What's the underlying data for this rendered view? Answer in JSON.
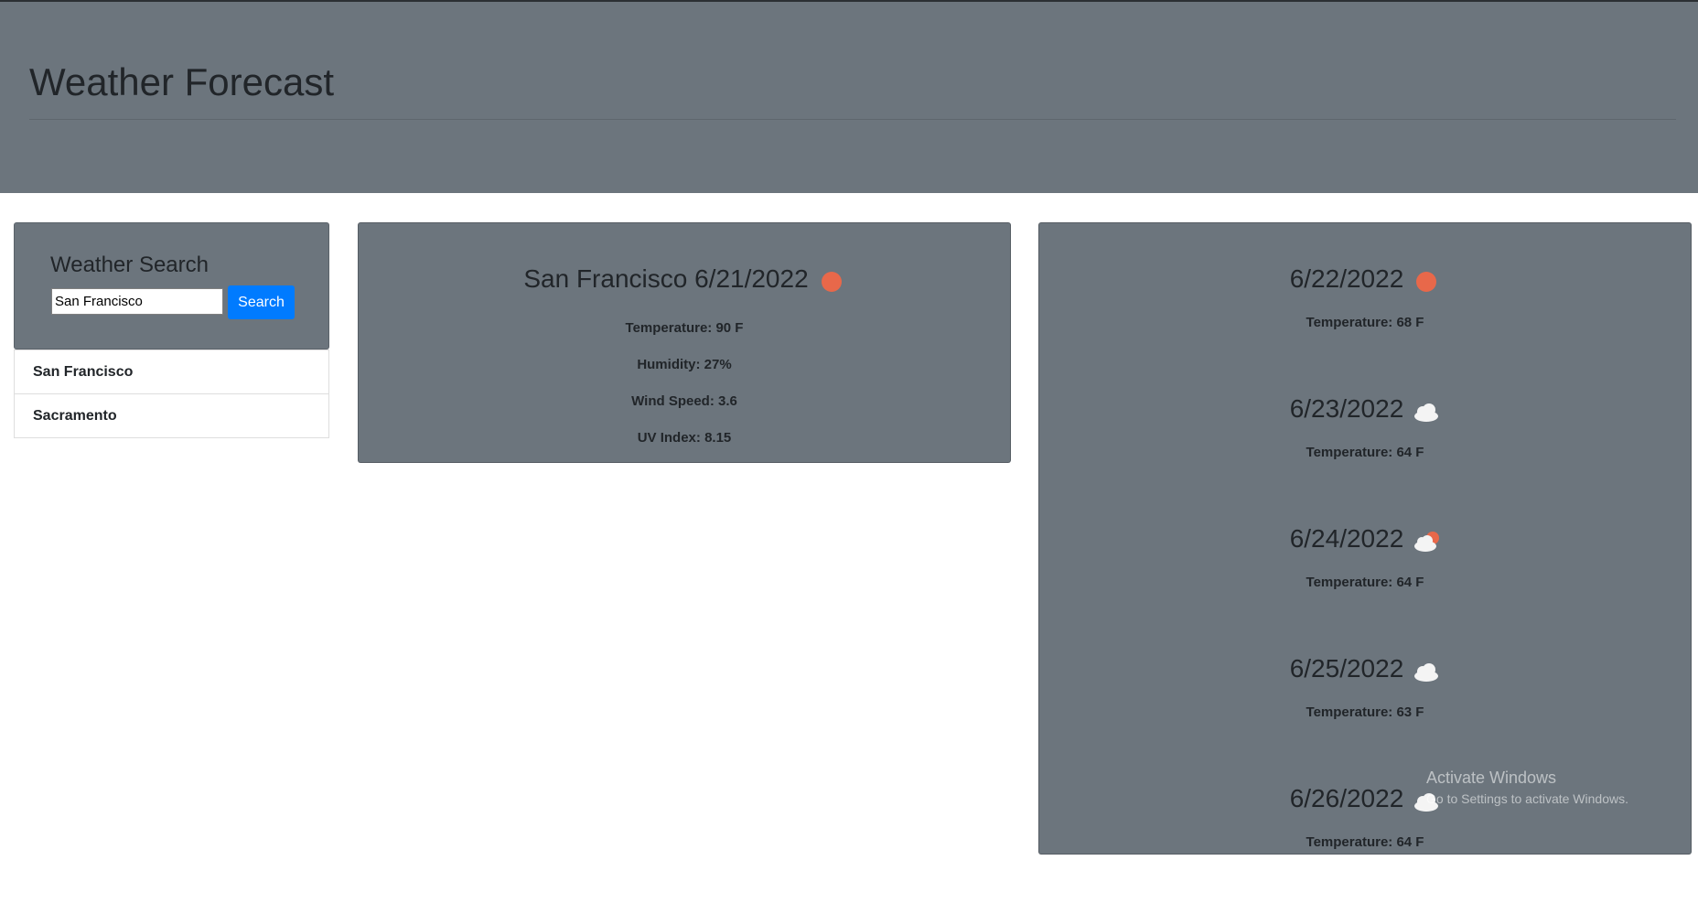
{
  "header": {
    "title": "Weather Forecast"
  },
  "search": {
    "title": "Weather Search",
    "input_value": "San Francisco",
    "button_label": "Search"
  },
  "history": [
    "San Francisco",
    "Sacramento"
  ],
  "current": {
    "title": "San Francisco 6/21/2022",
    "icon": "sun-icon",
    "temperature": "Temperature: 90 F",
    "humidity": "Humidity: 27%",
    "wind": "Wind Speed: 3.6",
    "uv": "UV Index: 8.15"
  },
  "forecast": [
    {
      "date": "6/22/2022",
      "icon": "sun-icon",
      "temp": "Temperature: 68 F"
    },
    {
      "date": "6/23/2022",
      "icon": "cloud-icon",
      "temp": "Temperature: 64 F"
    },
    {
      "date": "6/24/2022",
      "icon": "partly-cloudy-icon",
      "temp": "Temperature: 64 F"
    },
    {
      "date": "6/25/2022",
      "icon": "cloud-icon",
      "temp": "Temperature: 63 F"
    },
    {
      "date": "6/26/2022",
      "icon": "cloud-icon",
      "temp": "Temperature: 64 F"
    }
  ],
  "watermark": {
    "line1": "Activate Windows",
    "line2": "Go to Settings to activate Windows."
  },
  "colors": {
    "panel": "#6c757d",
    "accent": "#007bff",
    "sun": "#e8684a",
    "cloud": "#f4f4f4"
  }
}
